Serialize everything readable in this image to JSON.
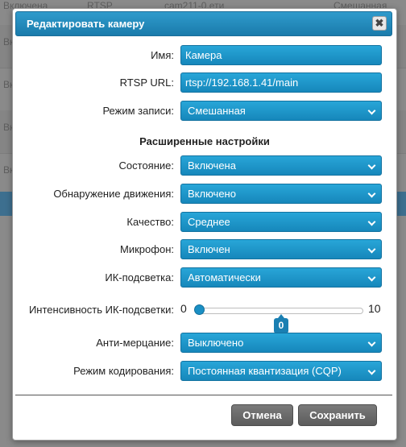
{
  "background": {
    "rows": [
      {
        "status": "Включена",
        "protocol": "RTSP",
        "name": "cam211-0.ети",
        "mode": "Смешанная"
      },
      {
        "status": "Вк"
      },
      {
        "status": "Вк"
      },
      {
        "status": "Вк"
      },
      {
        "status": "Вк"
      }
    ]
  },
  "dialog": {
    "title": "Редактировать камеру",
    "close_symbol": "✖",
    "fields": {
      "name": {
        "label": "Имя:",
        "value": "Камера"
      },
      "rtsp_url": {
        "label": "RTSP URL:",
        "value": "rtsp://192.168.1.41/main"
      },
      "record_mode": {
        "label": "Режим записи:",
        "value": "Смешанная"
      }
    },
    "advanced_title": "Расширенные настройки",
    "advanced": {
      "state": {
        "label": "Состояние:",
        "value": "Включена"
      },
      "motion_detection": {
        "label": "Обнаружение движения:",
        "value": "Включено"
      },
      "quality": {
        "label": "Качество:",
        "value": "Среднее"
      },
      "microphone": {
        "label": "Микрофон:",
        "value": "Включен"
      },
      "ir_light": {
        "label": "ИК-подсветка:",
        "value": "Автоматически"
      },
      "ir_intensity": {
        "label": "Интенсивность ИК-подсветки:",
        "min": "0",
        "max": "10",
        "value": "0"
      },
      "anti_flicker": {
        "label": "Анти-мерцание:",
        "value": "Выключено"
      },
      "encoding_mode": {
        "label": "Режим кодирования:",
        "value": "Постоянная квантизация (CQP)"
      }
    },
    "buttons": {
      "cancel": "Отмена",
      "save": "Сохранить"
    }
  },
  "colors": {
    "accent": "#1a8fc4",
    "button_dark": "#6a6a6a"
  }
}
